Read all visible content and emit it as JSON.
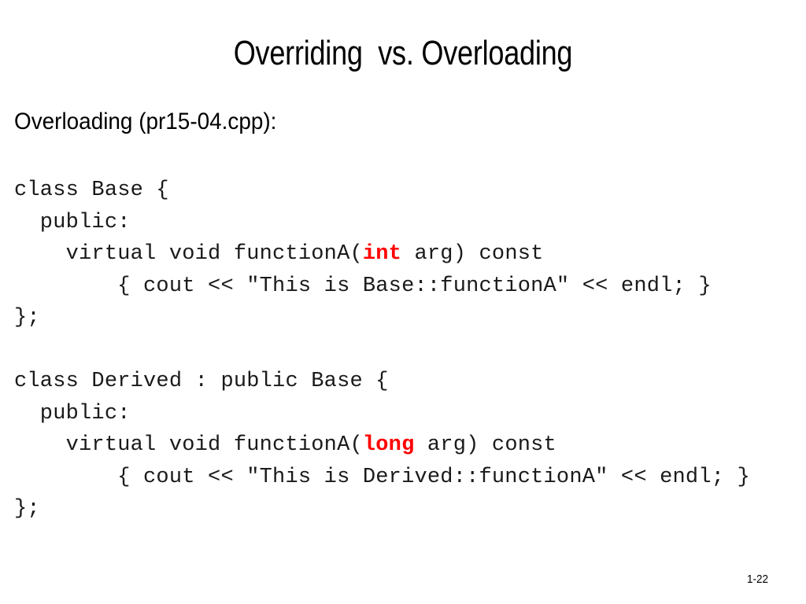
{
  "slide": {
    "title": "Overriding  vs. Overloading",
    "subtitle": "Overloading (pr15-04.cpp):",
    "page_number": "1-22",
    "accent_color": "#FF0000",
    "text_color": "#1a1a1a",
    "background_color": "#ffffff"
  },
  "code": {
    "base_class": {
      "line1": "class Base {",
      "line2": "  public:",
      "line3_pre": "    virtual void functionA(",
      "line3_keyword": "int",
      "line3_post": " arg) const",
      "line4": "        { cout << \"This is Base::functionA\" << endl; }",
      "line5": "};"
    },
    "derived_class": {
      "line1": "class Derived : public Base {",
      "line2": "  public:",
      "line3_pre": "    virtual void functionA(",
      "line3_keyword": "long",
      "line3_post": " arg) const",
      "line4": "        { cout << \"This is Derived::functionA\" << endl; }",
      "line5": "};"
    }
  }
}
